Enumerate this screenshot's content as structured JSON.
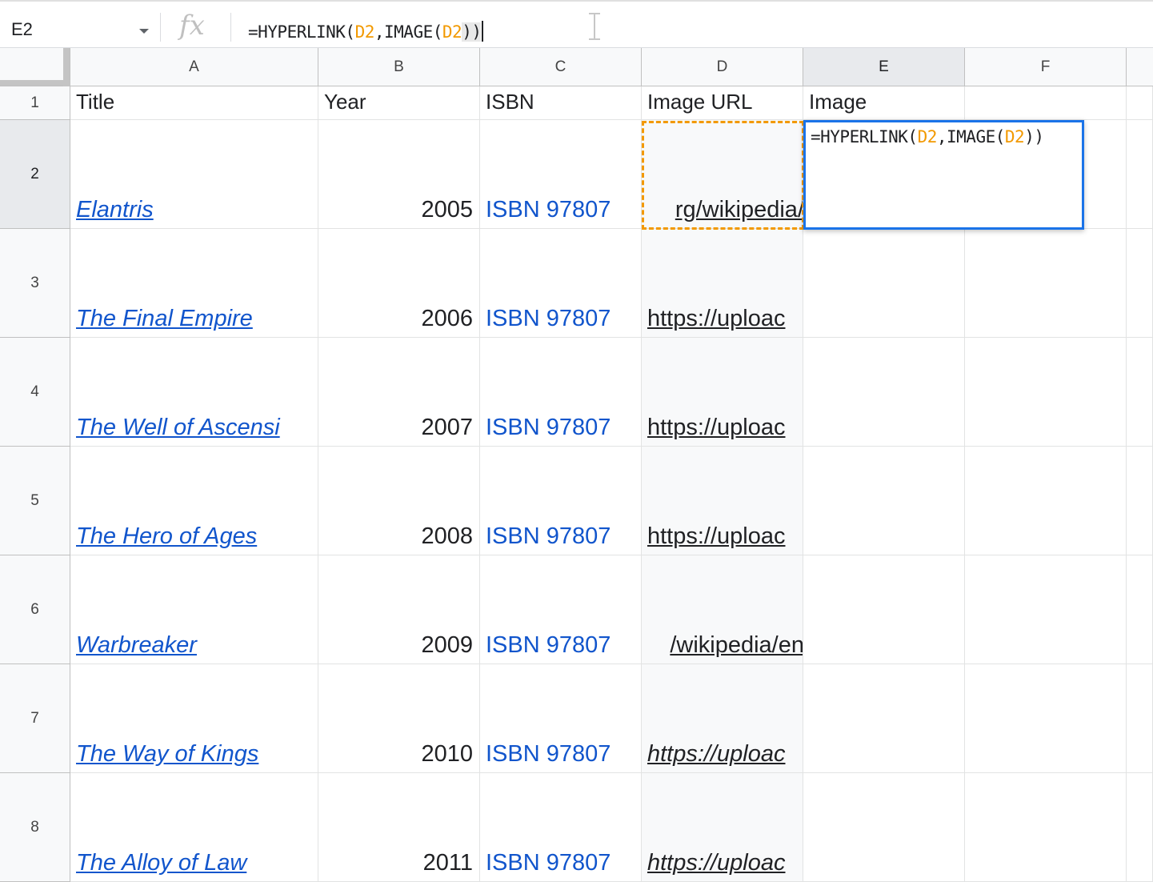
{
  "name_box": {
    "value": "E2"
  },
  "formula_bar": {
    "fx_label": "fx",
    "parts": {
      "p1": "=HYPERLINK(",
      "r1": "D2",
      "p2": ",IMAGE(",
      "r2": "D2",
      "p3": "))"
    }
  },
  "columns": [
    "A",
    "B",
    "C",
    "D",
    "E",
    "F"
  ],
  "rows": [
    "1",
    "2",
    "3",
    "4",
    "5",
    "6",
    "7",
    "8"
  ],
  "header_row": {
    "title": "Title",
    "year": "Year",
    "isbn": "ISBN",
    "image_url": "Image URL",
    "image": "Image"
  },
  "books": [
    {
      "title": "Elantris",
      "year": "2005",
      "isbn": "ISBN 97807",
      "url": "rg/wikipedia/"
    },
    {
      "title": "The Final Empire",
      "year": "2006",
      "isbn": "ISBN 97807",
      "url": "https://uploac"
    },
    {
      "title": "The Well of Ascensi",
      "year": "2007",
      "isbn": "ISBN 97807",
      "url": "https://uploac"
    },
    {
      "title": "The Hero of Ages",
      "year": "2008",
      "isbn": "ISBN 97807",
      "url": "https://uploac"
    },
    {
      "title": "Warbreaker",
      "year": "2009",
      "isbn": "ISBN 97807",
      "url": "/wikipedia/en"
    },
    {
      "title": "The Way of Kings",
      "year": "2010",
      "isbn": "ISBN 97807",
      "url": "https://uploac"
    },
    {
      "title": "The Alloy of Law",
      "year": "2011",
      "isbn": "ISBN 97807",
      "url": "https://uploac"
    }
  ],
  "editor": {
    "parts": {
      "p1": "=HYPERLINK(",
      "r1": "D2",
      "p2": ",IMAGE(",
      "r2": "D2",
      "p3": "))"
    }
  },
  "colors": {
    "selection": "#1a73e8",
    "reference": "#f29900",
    "link": "#1155cc"
  }
}
